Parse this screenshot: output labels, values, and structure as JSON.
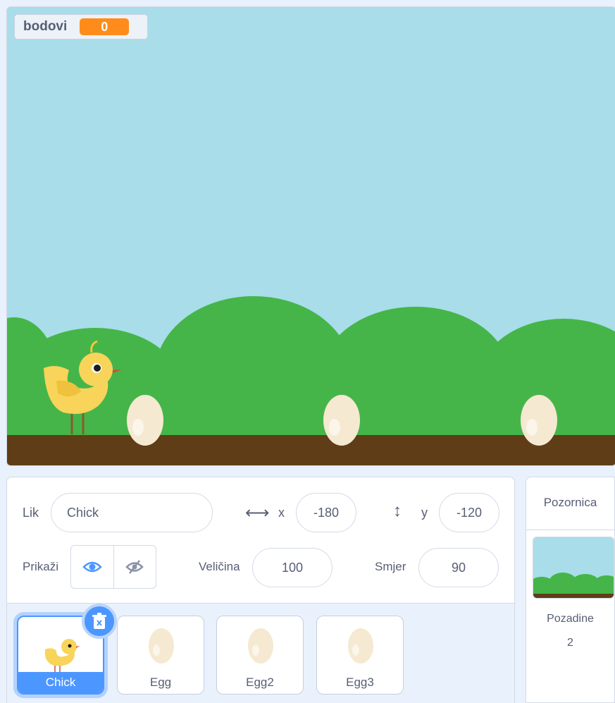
{
  "stage": {
    "variable": {
      "name": "bodovi",
      "value": "0"
    }
  },
  "sprite_info": {
    "sprite_label": "Lik",
    "sprite_name": "Chick",
    "x_label": "x",
    "x_value": "-180",
    "y_label": "y",
    "y_value": "-120",
    "show_label": "Prikaži",
    "size_label": "Veličina",
    "size_value": "100",
    "direction_label": "Smjer",
    "direction_value": "90"
  },
  "sprites": [
    {
      "name": "Chick",
      "selected": true
    },
    {
      "name": "Egg"
    },
    {
      "name": "Egg2"
    },
    {
      "name": "Egg3"
    }
  ],
  "stage_panel": {
    "title": "Pozornica",
    "backdrops_label": "Pozadine",
    "backdrops_count": "2"
  },
  "colors": {
    "sky": "#a8dde9",
    "hills": "#45b549",
    "ground": "#5e3d17",
    "accent": "#4c97ff",
    "variable": "#ff8c1a"
  }
}
